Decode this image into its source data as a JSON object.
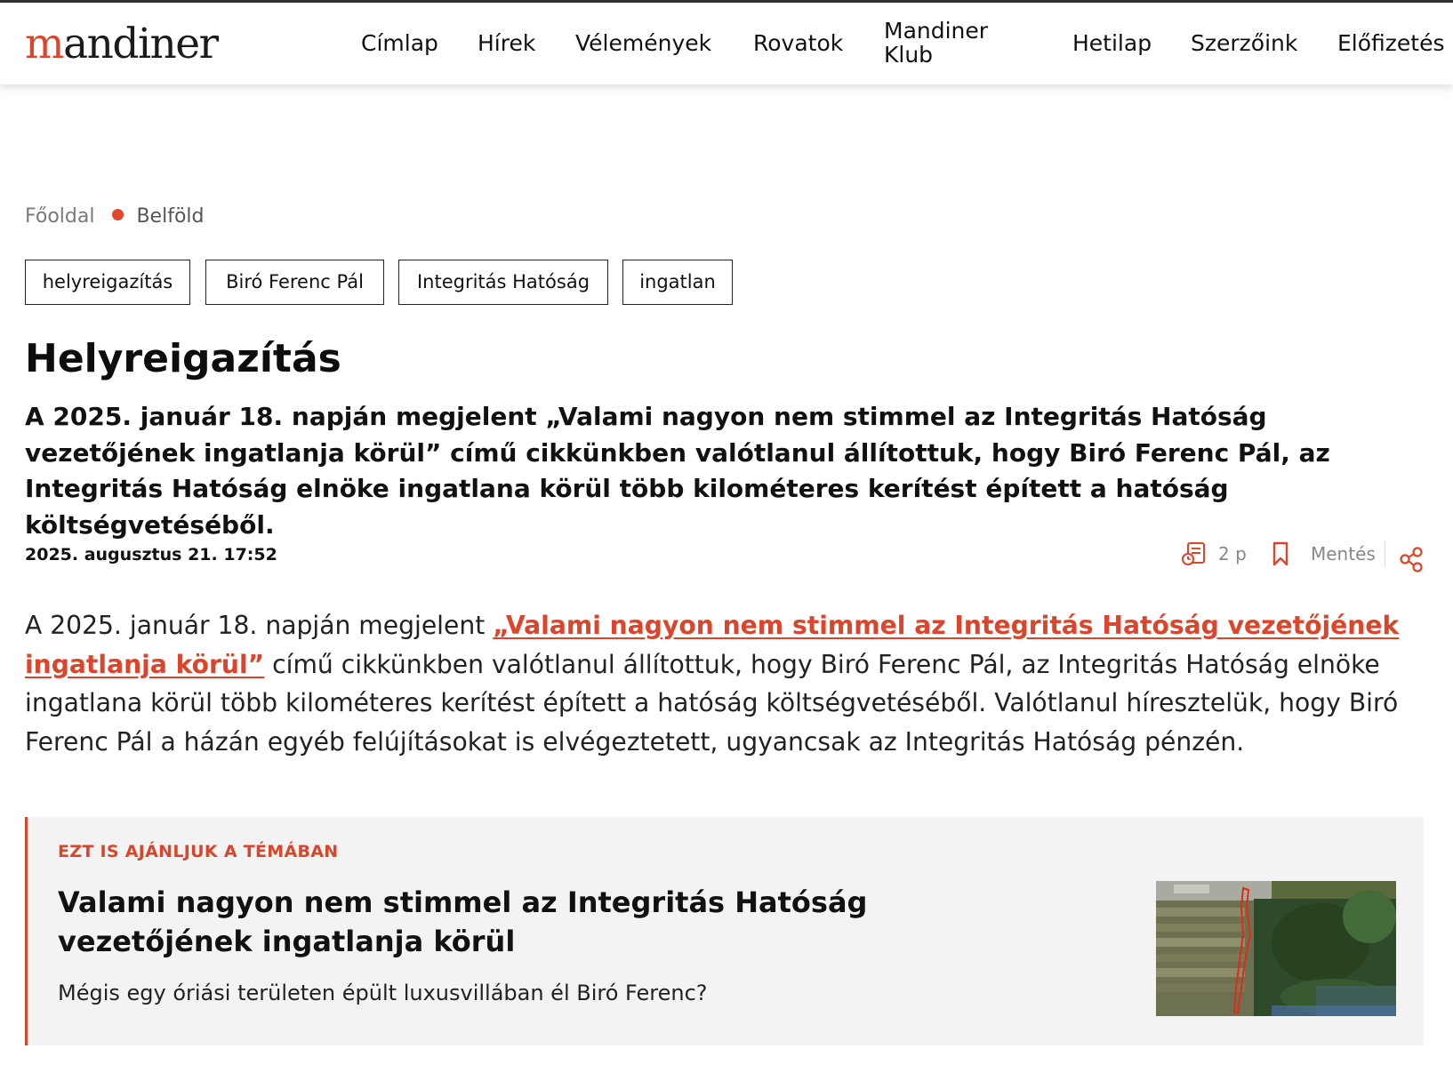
{
  "site": {
    "logo_prefix": "m",
    "logo_rest": "andiner"
  },
  "nav": {
    "items": [
      {
        "label": "Címlap"
      },
      {
        "label": "Hírek"
      },
      {
        "label": "Vélemények"
      },
      {
        "label": "Rovatok"
      },
      {
        "label": "Mandiner Klub"
      },
      {
        "label": "Hetilap"
      },
      {
        "label": "Szerzőink"
      },
      {
        "label": "Előfizetés"
      }
    ]
  },
  "breadcrumb": {
    "home": "Főoldal",
    "current": "Belföld"
  },
  "tags": [
    "helyreigazítás",
    "Biró Ferenc Pál",
    "Integritás Hatóság",
    "ingatlan"
  ],
  "article": {
    "title": "Helyreigazítás",
    "lead": "A 2025. január 18. napján megjelent „Valami nagyon nem stimmel az Integritás Hatóság vezetőjének ingatlanja körül” című cikkünkben valótlanul állítottuk, hogy Biró Ferenc Pál, az Integritás Hatóság elnöke ingatlana körül több kilométeres kerítést épített a hatóság költségvetéséből.",
    "date": "2025. augusztus 21. 17:52",
    "read_time": "2 p",
    "save_label": "Mentés",
    "body_before_link": "A 2025. január 18. napján megjelent ",
    "body_link": "„Valami nagyon nem stimmel az Integritás Hatóság vezetőjének ingatlanja körül”",
    "body_after_link": " című cikkünkben valótlanul állítottuk, hogy Biró Ferenc Pál, az Integritás Hatóság elnöke ingatlana körül több kilométeres kerítést épített a hatóság költségvetéséből. Valótlanul híresztelük, hogy Biró Ferenc Pál a házán egyéb felújításokat is elvégeztetett, ugyancsak az Integritás Hatóság pénzén."
  },
  "related": {
    "kicker": "EZT IS AJÁNLJUK A TÉMÁBAN",
    "title": "Valami nagyon nem stimmel az Integritás Hatóság vezetőjének ingatlanja körül",
    "subtitle": "Mégis egy óriási területen épült luxusvillában él Biró Ferenc?"
  },
  "colors": {
    "accent": "#d9462c",
    "related_bg": "#f3f3f3"
  },
  "icons": [
    "read-time-icon",
    "bookmark-icon",
    "share-icon"
  ]
}
